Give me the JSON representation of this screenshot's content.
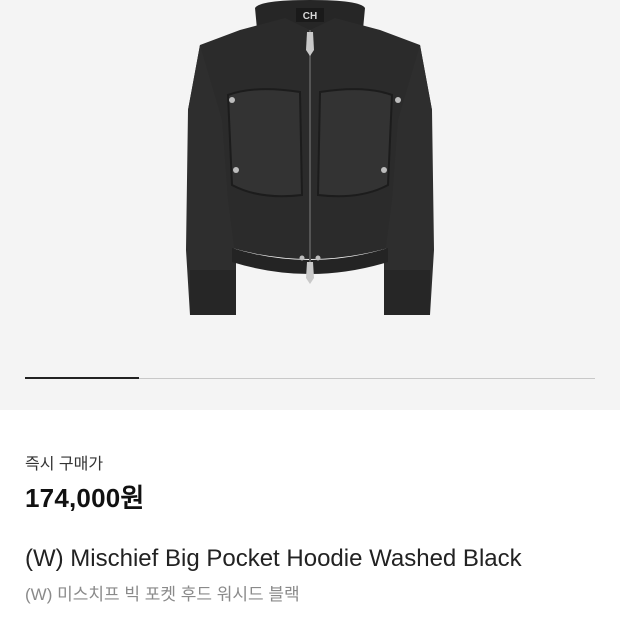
{
  "product": {
    "image_alt_icon": "hoodie-image",
    "logo_text": "CH",
    "price_label": "즉시 구매가",
    "price": "174,000원",
    "title": "(W) Mischief Big Pocket Hoodie Washed Black",
    "subtitle": "(W) 미스치프 빅 포켓 후드 워시드 블랙"
  },
  "gallery": {
    "current_fraction": 0.2
  },
  "colors": {
    "hero_bg": "#f4f4f4",
    "garment": "#2a2a2a"
  }
}
